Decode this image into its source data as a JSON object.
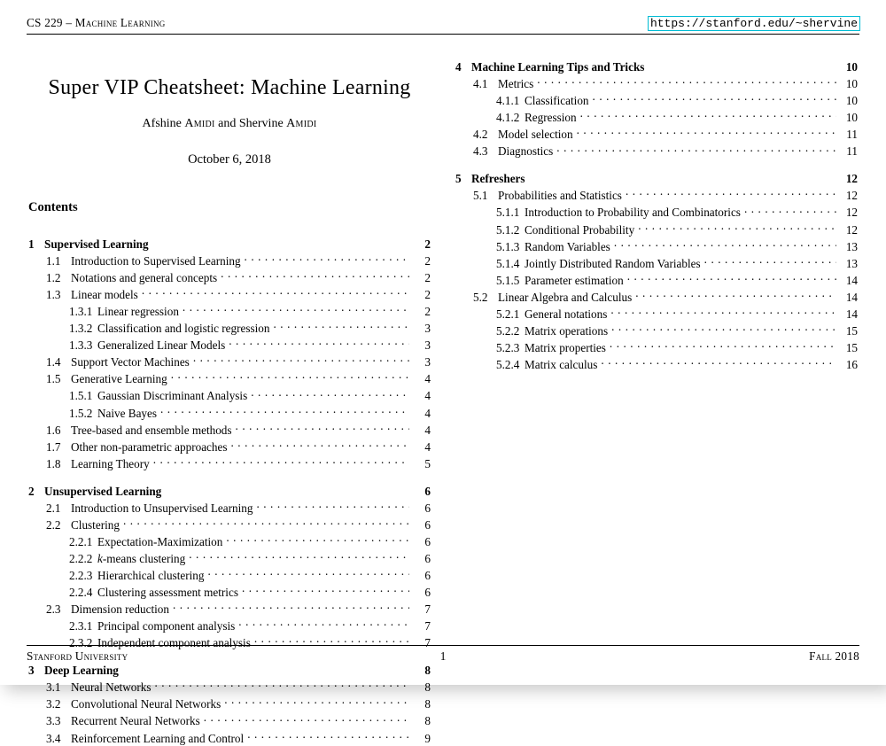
{
  "header": {
    "left": "CS 229 – Machine Learning",
    "right": "https://stanford.edu/~shervine"
  },
  "footer": {
    "left": "Stanford University",
    "center": "1",
    "right": "Fall 2018"
  },
  "title": "Super VIP Cheatsheet: Machine Learning",
  "authors_prefix": "Afshine ",
  "authors_sc1": "Amidi",
  "authors_mid": " and Shervine ",
  "authors_sc2": "Amidi",
  "date": "October 6, 2018",
  "contents_heading": "Contents",
  "toc_left": [
    {
      "type": "chapter",
      "num": "1",
      "title": "Supervised Learning",
      "page": "2",
      "first": true
    },
    {
      "type": "section",
      "num": "1.1",
      "title": "Introduction to Supervised Learning",
      "page": "2"
    },
    {
      "type": "section",
      "num": "1.2",
      "title": "Notations and general concepts",
      "page": "2"
    },
    {
      "type": "section",
      "num": "1.3",
      "title": "Linear models",
      "page": "2"
    },
    {
      "type": "subsection",
      "num": "1.3.1",
      "title": "Linear regression",
      "page": "2"
    },
    {
      "type": "subsection",
      "num": "1.3.2",
      "title": "Classification and logistic regression",
      "page": "3"
    },
    {
      "type": "subsection",
      "num": "1.3.3",
      "title": "Generalized Linear Models",
      "page": "3"
    },
    {
      "type": "section",
      "num": "1.4",
      "title": "Support Vector Machines",
      "page": "3"
    },
    {
      "type": "section",
      "num": "1.5",
      "title": "Generative Learning",
      "page": "4"
    },
    {
      "type": "subsection",
      "num": "1.5.1",
      "title": "Gaussian Discriminant Analysis",
      "page": "4"
    },
    {
      "type": "subsection",
      "num": "1.5.2",
      "title": "Naive Bayes",
      "page": "4"
    },
    {
      "type": "section",
      "num": "1.6",
      "title": "Tree-based and ensemble methods",
      "page": "4"
    },
    {
      "type": "section",
      "num": "1.7",
      "title": "Other non-parametric approaches",
      "page": "4"
    },
    {
      "type": "section",
      "num": "1.8",
      "title": "Learning Theory",
      "page": "5"
    },
    {
      "type": "chapter",
      "num": "2",
      "title": "Unsupervised Learning",
      "page": "6"
    },
    {
      "type": "section",
      "num": "2.1",
      "title": "Introduction to Unsupervised Learning",
      "page": "6"
    },
    {
      "type": "section",
      "num": "2.2",
      "title": "Clustering",
      "page": "6"
    },
    {
      "type": "subsection",
      "num": "2.2.1",
      "title": "Expectation-Maximization",
      "page": "6"
    },
    {
      "type": "subsection",
      "num": "2.2.2",
      "title": "k-means clustering",
      "page": "6",
      "italic_prefix": "k"
    },
    {
      "type": "subsection",
      "num": "2.2.3",
      "title": "Hierarchical clustering",
      "page": "6"
    },
    {
      "type": "subsection",
      "num": "2.2.4",
      "title": "Clustering assessment metrics",
      "page": "6"
    },
    {
      "type": "section",
      "num": "2.3",
      "title": "Dimension reduction",
      "page": "7"
    },
    {
      "type": "subsection",
      "num": "2.3.1",
      "title": "Principal component analysis",
      "page": "7"
    },
    {
      "type": "subsection",
      "num": "2.3.2",
      "title": "Independent component analysis",
      "page": "7"
    },
    {
      "type": "chapter",
      "num": "3",
      "title": "Deep Learning",
      "page": "8"
    },
    {
      "type": "section",
      "num": "3.1",
      "title": "Neural Networks",
      "page": "8"
    },
    {
      "type": "section",
      "num": "3.2",
      "title": "Convolutional Neural Networks",
      "page": "8"
    },
    {
      "type": "section",
      "num": "3.3",
      "title": "Recurrent Neural Networks",
      "page": "8"
    },
    {
      "type": "section",
      "num": "3.4",
      "title": "Reinforcement Learning and Control",
      "page": "9"
    }
  ],
  "toc_right": [
    {
      "type": "chapter",
      "num": "4",
      "title": "Machine Learning Tips and Tricks",
      "page": "10",
      "first": true
    },
    {
      "type": "section",
      "num": "4.1",
      "title": "Metrics",
      "page": "10"
    },
    {
      "type": "subsection",
      "num": "4.1.1",
      "title": "Classification",
      "page": "10"
    },
    {
      "type": "subsection",
      "num": "4.1.2",
      "title": "Regression",
      "page": "10"
    },
    {
      "type": "section",
      "num": "4.2",
      "title": "Model selection",
      "page": "11"
    },
    {
      "type": "section",
      "num": "4.3",
      "title": "Diagnostics",
      "page": "11"
    },
    {
      "type": "chapter",
      "num": "5",
      "title": "Refreshers",
      "page": "12"
    },
    {
      "type": "section",
      "num": "5.1",
      "title": "Probabilities and Statistics",
      "page": "12"
    },
    {
      "type": "subsection",
      "num": "5.1.1",
      "title": "Introduction to Probability and Combinatorics",
      "page": "12"
    },
    {
      "type": "subsection",
      "num": "5.1.2",
      "title": "Conditional Probability",
      "page": "12"
    },
    {
      "type": "subsection",
      "num": "5.1.3",
      "title": "Random Variables",
      "page": "13"
    },
    {
      "type": "subsection",
      "num": "5.1.4",
      "title": "Jointly Distributed Random Variables",
      "page": "13"
    },
    {
      "type": "subsection",
      "num": "5.1.5",
      "title": "Parameter estimation",
      "page": "14"
    },
    {
      "type": "section",
      "num": "5.2",
      "title": "Linear Algebra and Calculus",
      "page": "14"
    },
    {
      "type": "subsection",
      "num": "5.2.1",
      "title": "General notations",
      "page": "14"
    },
    {
      "type": "subsection",
      "num": "5.2.2",
      "title": "Matrix operations",
      "page": "15"
    },
    {
      "type": "subsection",
      "num": "5.2.3",
      "title": "Matrix properties",
      "page": "15"
    },
    {
      "type": "subsection",
      "num": "5.2.4",
      "title": "Matrix calculus",
      "page": "16"
    }
  ]
}
